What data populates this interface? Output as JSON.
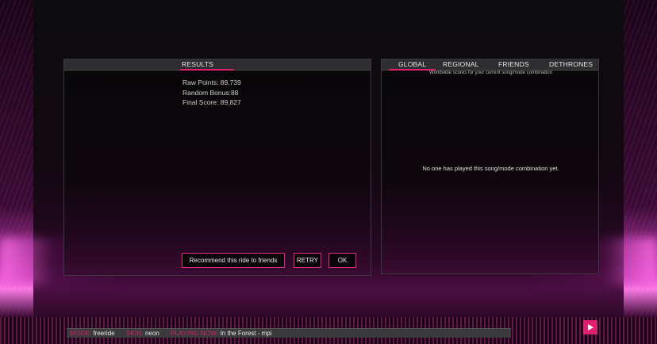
{
  "results_panel": {
    "tab_label": "RESULTS",
    "raw_points": "Raw Points: 89,739",
    "random_bonus": "Random Bonus:88",
    "final_score": "Final Score: 89,827",
    "buttons": {
      "recommend": "Recommend this ride to friends",
      "retry": "RETRY",
      "ok": "OK"
    }
  },
  "scores_panel": {
    "tabs": [
      "GLOBAL",
      "REGIONAL",
      "FRIENDS",
      "DETHRONES"
    ],
    "active_tab": "GLOBAL",
    "subtitle": "Worldwide scores for your current song/mode combination",
    "empty_message": "No one has played this song/mode combination yet."
  },
  "status_bar": {
    "mode_label": "MODE:",
    "mode_value": "freeride",
    "skin_label": "SKIN:",
    "skin_value": "neon",
    "playing_label": "PLAYING NOW:",
    "playing_value": "In the Forest - mpi"
  },
  "play_button": {
    "icon": "play-icon"
  },
  "colors": {
    "accent": "#e0206e",
    "panel_bg": "#0e070c",
    "tabbar_bg": "#2e2e31",
    "glow": "#ff7ee8"
  }
}
